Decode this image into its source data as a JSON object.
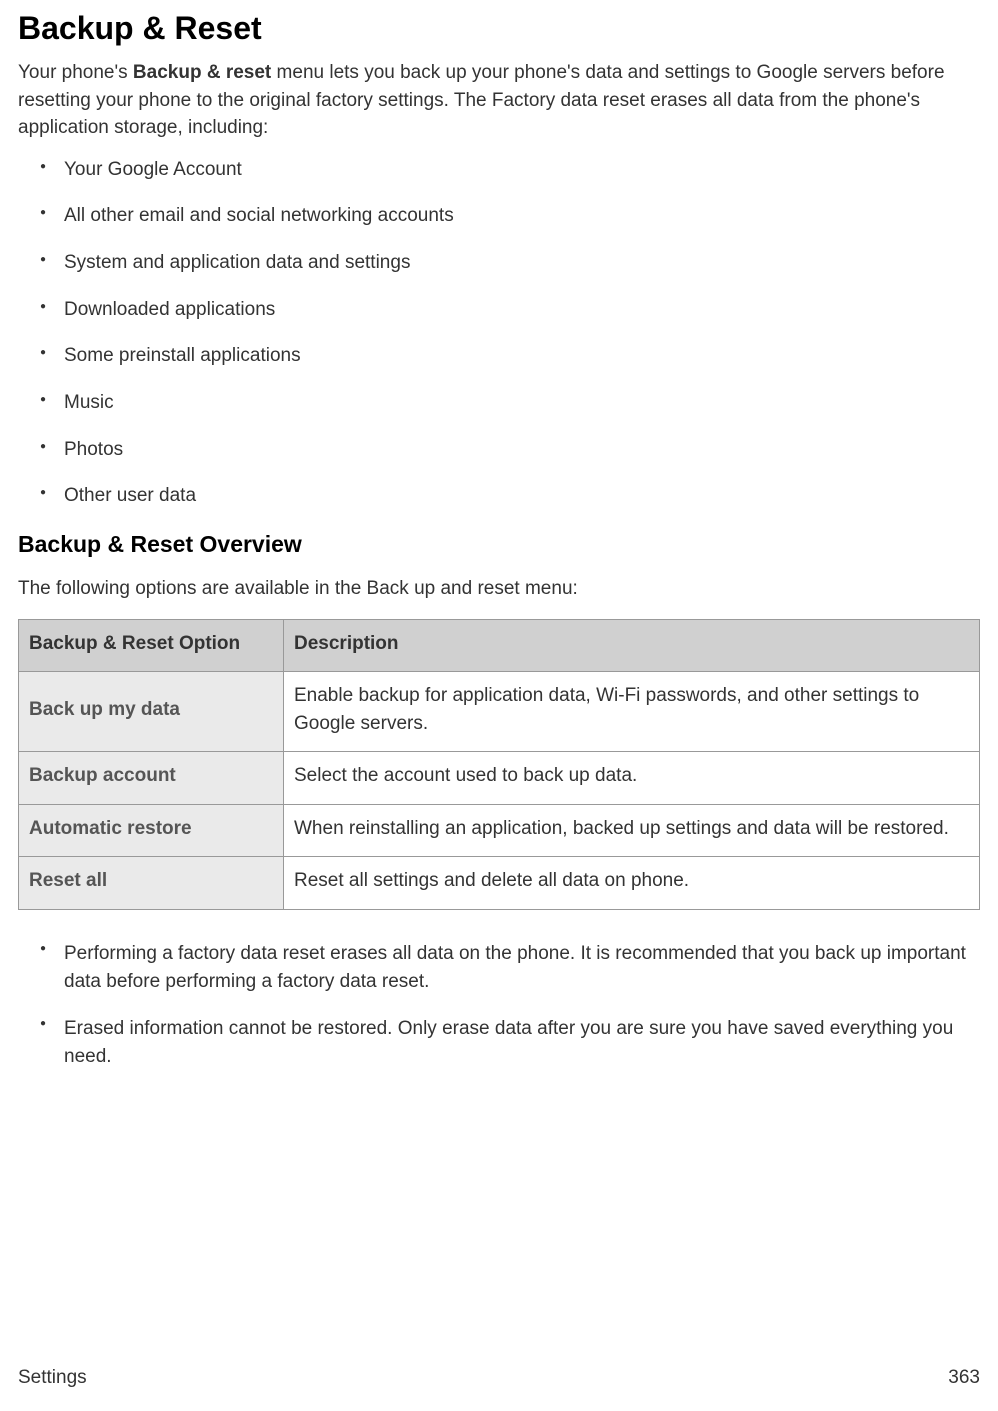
{
  "title": "Backup & Reset",
  "intro_pre": "Your phone's ",
  "intro_bold": "Backup & reset",
  "intro_post": " menu lets you back up your phone's data and settings to Google servers before resetting your phone to the original factory settings. The Factory data reset erases all data from the phone's application storage, including:",
  "bullets": [
    "Your Google Account",
    "All other email and social networking accounts",
    "System and application data and settings",
    "Downloaded applications",
    "Some preinstall applications",
    "Music",
    "Photos",
    "Other user data"
  ],
  "subheading": "Backup & Reset Overview",
  "subtext": "The following options are available in the Back up and reset menu:",
  "table": {
    "headers": [
      "Backup & Reset Option",
      "Description"
    ],
    "rows": [
      {
        "option": "Back up my data",
        "desc": "Enable backup for application data, Wi-Fi passwords, and other settings to Google servers."
      },
      {
        "option": "Backup account",
        "desc": "Select the account used to back up data."
      },
      {
        "option": "Automatic restore",
        "desc": "When reinstalling an application, backed up settings and data will be restored."
      },
      {
        "option": "Reset all",
        "desc": "Reset all settings and delete all data on phone."
      }
    ]
  },
  "notes": [
    "Performing a factory data reset erases all data on the phone. It is recommended that you back up important data before performing a factory data reset.",
    "Erased information cannot be restored. Only erase data after you are sure you have saved everything you need."
  ],
  "footer_left": "Settings",
  "footer_right": "363"
}
